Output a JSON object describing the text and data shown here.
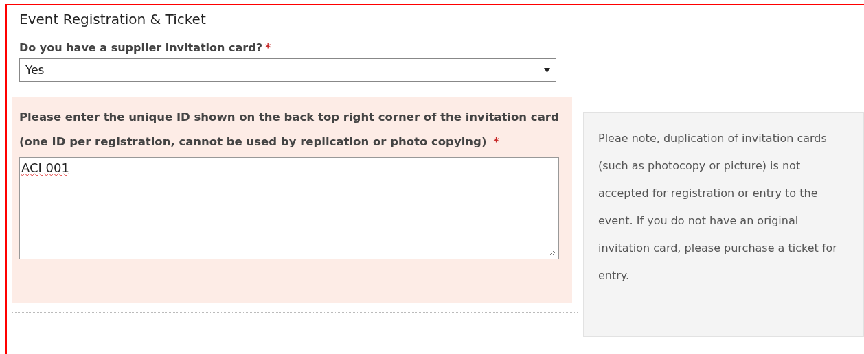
{
  "section_title": "Event Registration & Ticket",
  "invitation_question": {
    "label": "Do you have a supplier invitation card?",
    "required_mark": "*",
    "value": "Yes"
  },
  "unique_id": {
    "label": "Please enter the unique ID shown on the back top right corner of the invitation card (one ID per registration, cannot be used by replication or photo copying)",
    "required_mark": "*",
    "value": "ACI 001",
    "highlighted": true
  },
  "note": "Pleae note, duplication of invitation cards (such as photocopy or picture) is not accepted for registration or entry to the event. If you do not have an original invitation card, please purchase a ticket for entry."
}
